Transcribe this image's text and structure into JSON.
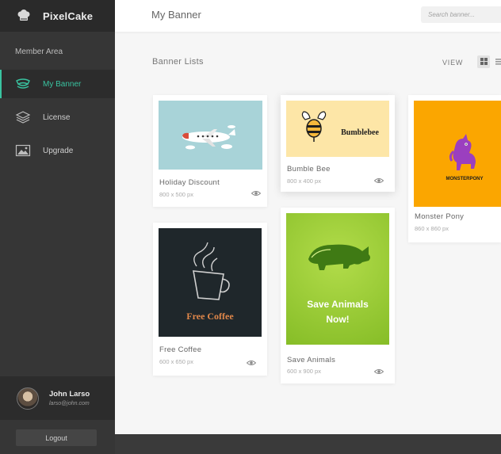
{
  "app": {
    "brand": "PixelCake"
  },
  "sidebar": {
    "section_label": "Member Area",
    "items": [
      {
        "label": "My Banner",
        "icon": "banner-icon",
        "active": true
      },
      {
        "label": "License",
        "icon": "layers-icon",
        "active": false
      },
      {
        "label": "Upgrade",
        "icon": "image-icon",
        "active": false
      }
    ],
    "user": {
      "name": "John Larso",
      "email": "larso@john.com"
    },
    "logout_label": "Logout"
  },
  "header": {
    "title": "My Banner",
    "search_placeholder": "Search banner..."
  },
  "content": {
    "section_title": "Banner Lists",
    "view_label": "VIEW",
    "view_modes": [
      "grid-icon",
      "list-icon"
    ],
    "selected_view": "grid"
  },
  "banners": [
    {
      "name": "Holiday Discount",
      "size": "800 x 500 px",
      "bg": "#a8d3d8"
    },
    {
      "name": "Free Coffee",
      "size": "600 x 650 px",
      "bg": "#1f272b",
      "overlay": "Free Coffee",
      "overlay_color": "#e0874a"
    },
    {
      "name": "Bumble Bee",
      "size": "800 x 400 px",
      "bg": "#fde6a7",
      "overlay": "Bumblebee"
    },
    {
      "name": "Save Animals",
      "size": "600 x 900 px",
      "bg": "#8fc630",
      "overlay_line1": "Save Animals",
      "overlay_line2": "Now!"
    },
    {
      "name": "Monster Pony",
      "size": "860 x 860 px",
      "bg": "#fba600",
      "overlay": "MONSTERPONY"
    }
  ],
  "colors": {
    "accent": "#39c3a0",
    "sidebar_bg": "#363636",
    "sidebar_header_bg": "#2a2a2a"
  }
}
